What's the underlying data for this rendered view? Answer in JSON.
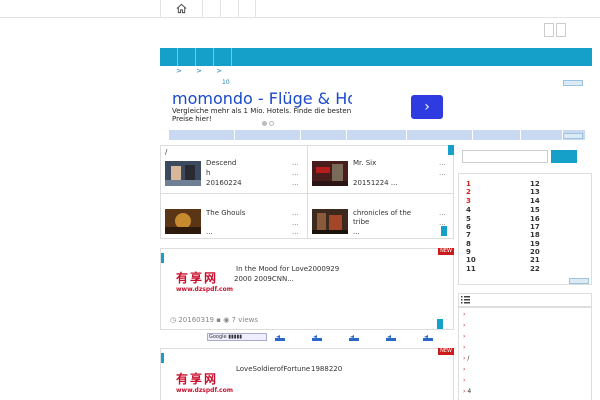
{
  "breadcrumb": [
    ">",
    ">",
    ">"
  ],
  "crumb_count": "10",
  "ad": {
    "title": "momondo - Flüge & Hotels",
    "description": "Vergleiche mehr als 1 Mio. Hotels. Finde die besten Preise hier!",
    "cta": "›"
  },
  "grid": {
    "slash": "/",
    "ellipsis": "...",
    "items": [
      {
        "title": "Descend",
        "title2": "h",
        "date": "20160224"
      },
      {
        "title": "Mr. Six",
        "title2": "",
        "date": "20151224 ..."
      },
      {
        "title": "The Ghouls",
        "title2": "",
        "date": "..."
      },
      {
        "title": "chronicles of the",
        "title2": "tribe",
        "date": "..."
      }
    ]
  },
  "posts": [
    {
      "new": "NEW",
      "title": "In the Mood for Love",
      "year": "2000929",
      "line2": "2000 2009CNN...",
      "logo_main": "有享网",
      "logo_sub": "www.dzspdf.com",
      "date": "20160319",
      "views": "7 views"
    },
    {
      "new": "NEW",
      "title": "LoveSoldierofFortune",
      "year": "1988220",
      "line2": "",
      "logo_main": "有享网",
      "logo_sub": "www.dzspdf.com"
    }
  ],
  "share_label": "Google",
  "ranking": {
    "left": [
      "1",
      "2",
      "3",
      "4",
      "5",
      "6",
      "7",
      "8",
      "9",
      "10",
      "11"
    ],
    "right": [
      "12",
      "13",
      "14",
      "15",
      "16",
      "17",
      "18",
      "19",
      "20",
      "21",
      "22"
    ]
  },
  "sidebar_list": [
    "",
    "",
    "",
    "",
    "/",
    "",
    "",
    "4"
  ],
  "colors": {
    "accent": "#14a0c8",
    "new": "#cc1b1b",
    "rank_red": "#d1231f"
  }
}
